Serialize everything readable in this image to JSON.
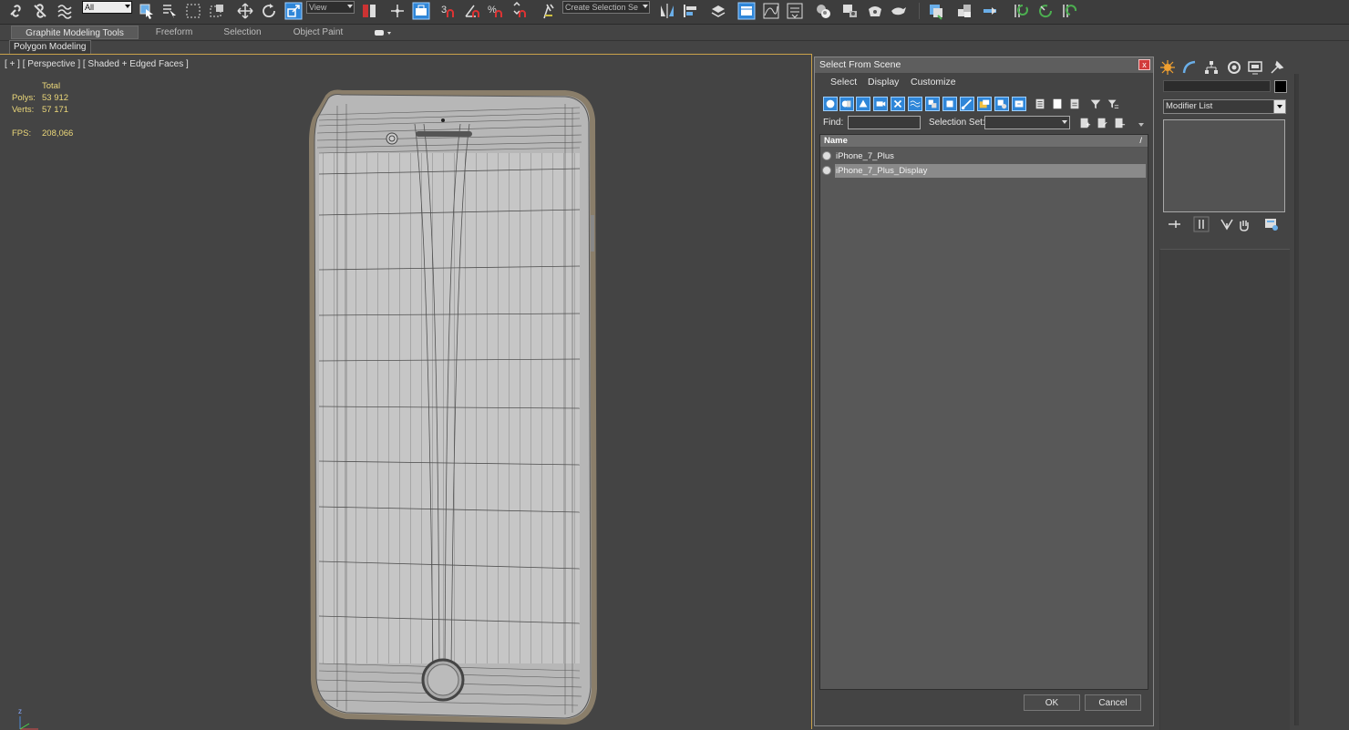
{
  "toolbar": {
    "selection_filter": "All",
    "ref_coord": "View",
    "named_selection_set": "Create Selection Se",
    "snap_labels": {
      "snap": "3",
      "angle": "",
      "percent": "%"
    }
  },
  "ribbon": {
    "tabs": [
      {
        "label": "Graphite Modeling Tools",
        "active": true
      },
      {
        "label": "Freeform",
        "active": false
      },
      {
        "label": "Selection",
        "active": false
      },
      {
        "label": "Object Paint",
        "active": false
      }
    ],
    "panel_label": "Polygon Modeling"
  },
  "viewport": {
    "label": "[ + ] [ Perspective ] [ Shaded + Edged Faces ]",
    "stats": {
      "total_label": "Total",
      "polys_label": "Polys:",
      "polys_value": "53 912",
      "verts_label": "Verts:",
      "verts_value": "57 171",
      "fps_label": "FPS:",
      "fps_value": "208,066"
    },
    "axis_label": "z"
  },
  "dialog": {
    "title": "Select From Scene",
    "close_glyph": "x",
    "menu": [
      "Select",
      "Display",
      "Customize"
    ],
    "find_label": "Find:",
    "find_value": "",
    "selection_set_label": "Selection Set:",
    "selection_set_value": "",
    "list_header": "Name",
    "sort_indicator": "/",
    "items": [
      {
        "name": "iPhone_7_Plus",
        "selected": false
      },
      {
        "name": "iPhone_7_Plus_Display",
        "selected": true
      }
    ],
    "ok_label": "OK",
    "cancel_label": "Cancel"
  },
  "command_panel": {
    "tabs": [
      "create-icon",
      "modify-icon",
      "hierarchy-icon",
      "motion-icon",
      "display-icon",
      "utilities-icon"
    ],
    "object_name": "",
    "object_color": "#000000",
    "modifier_list": "Modifier List"
  },
  "colors": {
    "viewport_border": "#caa24a",
    "stat_text": "#ecd87a",
    "accent_blue": "#2f86d8",
    "list_selected": "#8a8a8a"
  }
}
